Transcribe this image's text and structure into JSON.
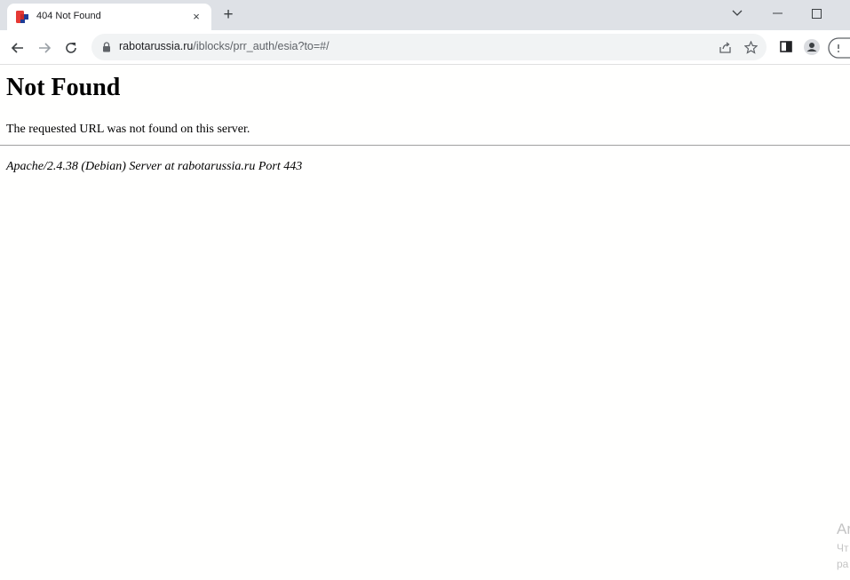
{
  "browser": {
    "tab": {
      "title": "404 Not Found",
      "close_glyph": "×"
    },
    "new_tab_glyph": "+",
    "window_controls": {
      "tab_search": "⌄",
      "minimize": "–",
      "maximize": "☐"
    },
    "address_bar": {
      "host": "rabotarussia.ru",
      "path": "/iblocks/prr_auth/esia?to=#/"
    },
    "toolbar_icons": [
      "back-arrow-icon",
      "forward-arrow-icon",
      "reload-icon",
      "lock-icon",
      "share-icon",
      "star-icon",
      "side-panel-icon",
      "profile-icon",
      "update-icon"
    ]
  },
  "page": {
    "heading": "Not Found",
    "message": "The requested URL was not found on this server.",
    "server_signature": "Apache/2.4.38 (Debian) Server at rabotarussia.ru Port 443"
  },
  "windows_watermark": {
    "line1": "Ar",
    "line2": "Чт",
    "line3": "ра"
  },
  "colors": {
    "tabstrip_bg": "#dee1e6",
    "omnibox_bg": "#f1f3f4",
    "favicon_red": "#e53935",
    "favicon_blue": "#1e3c96"
  }
}
